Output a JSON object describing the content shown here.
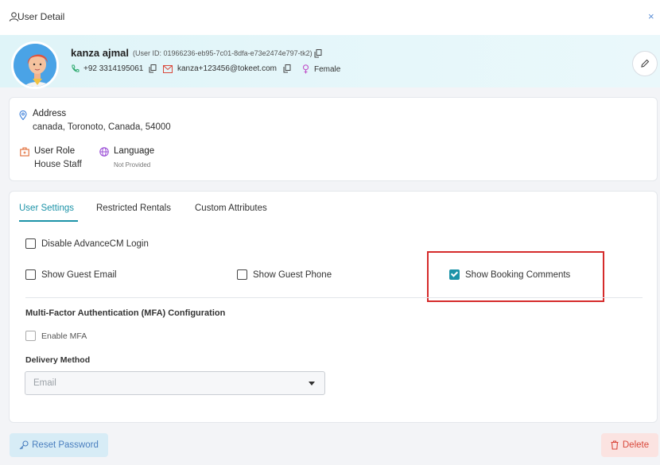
{
  "window": {
    "title": "User Detail",
    "close_label": "×"
  },
  "profile": {
    "name": "kanza ajmal",
    "user_id": "(User ID: 01966236-eb95-7c01-8dfa-e73e2474e797-tk2)",
    "phone": "+92 3314195061",
    "email": "kanza+123456@tokeet.com",
    "gender": "Female",
    "colors": {
      "banner": "#e1f5f9",
      "accent": "#1c93a8"
    }
  },
  "info": {
    "address_label": "Address",
    "address_value": "canada, Toronoto, Canada, 54000",
    "role_label": "User Role",
    "role_value": "House Staff",
    "language_label": "Language",
    "language_value": "Not Provided"
  },
  "tabs": [
    {
      "label": "User Settings",
      "active": true
    },
    {
      "label": "Restricted Rentals",
      "active": false
    },
    {
      "label": "Custom Attributes",
      "active": false
    }
  ],
  "settings": {
    "disable_advancecm": {
      "label": "Disable AdvanceCM Login",
      "checked": false
    },
    "show_guest_email": {
      "label": "Show Guest Email",
      "checked": false
    },
    "show_guest_phone": {
      "label": "Show Guest Phone",
      "checked": false
    },
    "show_booking_comments": {
      "label": "Show Booking Comments",
      "checked": true
    }
  },
  "mfa": {
    "title": "Multi-Factor Authentication (MFA) Configuration",
    "enable_label": "Enable MFA",
    "enabled": false,
    "delivery_label": "Delivery Method",
    "delivery_value": "Email"
  },
  "footer": {
    "reset_label": "Reset Password",
    "delete_label": "Delete"
  }
}
